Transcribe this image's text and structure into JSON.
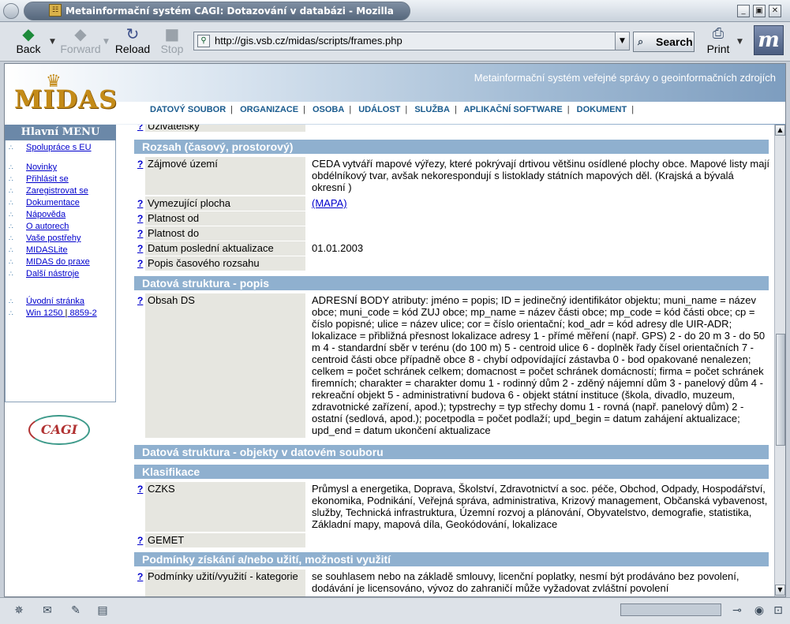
{
  "window": {
    "title": "Metainformační systém CAGI: Dotazování v databázi - Mozilla",
    "controls": [
      "_",
      "▣",
      "✕"
    ]
  },
  "toolbar": {
    "back": "Back",
    "forward": "Forward",
    "reload": "Reload",
    "stop": "Stop",
    "url": "http://gis.vsb.cz/midas/scripts/frames.php",
    "search": "Search",
    "print": "Print"
  },
  "header": {
    "logo": "MIDAS",
    "subtitle": "Metainformační systém veřejné správy o geoinformačních zdrojích",
    "nav": [
      "DATOVÝ SOUBOR",
      "ORGANIZACE",
      "OSOBA",
      "UDÁLOST",
      "SLUŽBA",
      "APLIKAČNÍ SOFTWARE",
      "DOKUMENT"
    ]
  },
  "menu": {
    "title": "Hlavní MENU",
    "items": [
      "Spolupráce s EU",
      "Novinky",
      "Přihlásit se",
      "Zaregistrovat se",
      "Dokumentace",
      "Nápověda",
      "O autorech",
      "Vaše postřehy",
      "MIDASLite",
      "MIDAS do praxe",
      "Další nástroje",
      "Úvodní stránka"
    ],
    "encoding": [
      "Win 1250",
      "8859-2"
    ],
    "partner_logo": "CAGI"
  },
  "content": {
    "clipped_row": "Uživatelský",
    "sections": {
      "rozsah": "Rozsah (časový, prostorový)",
      "popis": "Datová struktura - popis",
      "objekty": "Datová struktura - objekty v datovém souboru",
      "klasifikace": "Klasifikace",
      "podminky": "Podmínky získání a/nebo užití, možnosti využití"
    },
    "help_mark": "?",
    "rows": {
      "zajmove_label": "Zájmové území",
      "zajmove_value": "CEDA vytváří mapové výřezy, které pokrývají drtivou většinu osídlené plochy obce. Mapové listy mají obdélníkový tvar, avšak nekorespondují s listoklady státních mapových děl. (Krajská a bývalá okresní )",
      "vymezujici_label": "Vymezující plocha",
      "vymezujici_value": "(MAPA)",
      "platnost_od_label": "Platnost od",
      "platnost_do_label": "Platnost do",
      "datum_label": "Datum poslední aktualizace",
      "datum_value": "01.01.2003",
      "popis_casu_label": "Popis časového rozsahu",
      "obsah_label": "Obsah DS",
      "obsah_value": "ADRESNÍ BODY atributy: jméno = popis; ID = jedinečný identifikátor objektu; muni_name = název obce; muni_code = kód ZUJ obce; mp_name = název části obce; mp_code = kód části obce; cp = číslo popisné; ulice = název ulice; cor = číslo orientační; kod_adr = kód adresy dle UIR-ADR; lokalizace = přibližná přesnost lokalizace adresy 1 - přímé měření (např. GPS) 2 - do 20 m 3 - do 50 m 4 - standardní sběr v terénu (do 100 m) 5 - centroid ulice 6 - doplněk řady čísel orientačních 7 - centroid části obce případně obce 8 - chybí odpovídající zástavba 0 - bod opakované nenalezen; celkem = počet schránek celkem; domacnost = počet schránek domácností; firma = počet schránek firemních; charakter = charakter domu 1 - rodinný dům 2 - zděný nájemní dům 3 - panelový dům 4 - rekreační objekt 5 - administrativní budova 6 - objekt státní instituce (škola, divadlo, muzeum, zdravotnické zařízení, apod.); typstrechy = typ střechy domu 1 - rovná (např. panelový dům) 2 - ostatní (sedlová, apod.); pocetpodla = počet podlaží; upd_begin = datum zahájení aktualizace; upd_end = datum ukončení aktualizace",
      "czks_label": "CZKS",
      "czks_value": "Průmysl a energetika, Doprava, Školství, Zdravotnictví a soc. péče, Obchod, Odpady, Hospodářství, ekonomika, Podnikání, Veřejná správa, administrativa, Krizový management, Občanská vybavenost, služby, Technická infrastruktura, Územní rozvoj a plánování, Obyvatelstvo, demografie, statistika, Základní mapy, mapová díla, Geokódování, lokalizace",
      "gemet_label": "GEMET",
      "podminky_label": "Podmínky užití/využití - kategorie",
      "podminky_value": "se souhlasem nebo na základě smlouvy, licenční poplatky, nesmí být prodáváno bez povolení, dodávání je licensováno, vývoz do zahraničí může vyžadovat zvláštní povolení"
    }
  },
  "colors": {
    "section_bg": "#8fb0cf",
    "label_bg": "#e6e6e0",
    "link": "#0000cc",
    "nav_text": "#1a5b8e"
  }
}
